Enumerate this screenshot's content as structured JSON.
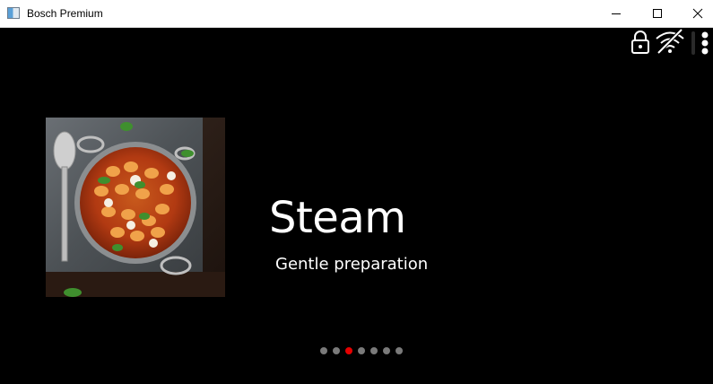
{
  "window": {
    "title": "Bosch Premium",
    "controls": [
      "minimize",
      "maximize",
      "close"
    ]
  },
  "status_icons": [
    "lock-icon",
    "wifi-off-icon",
    "more-menu-icon"
  ],
  "carousel": {
    "image": "gnocchi-in-tomato-sauce-pan",
    "headline": "Steam",
    "subline": "Gentle preparation",
    "page_count": 7,
    "active_page": 3,
    "active_color": "#e60000",
    "inactive_color": "#7a7a7a"
  }
}
